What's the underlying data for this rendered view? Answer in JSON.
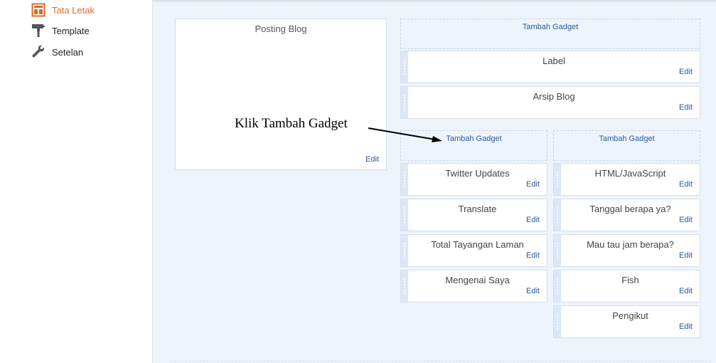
{
  "sidebar": {
    "items": [
      {
        "label": "Tata Letak",
        "icon": "layout-icon",
        "active": true
      },
      {
        "label": "Template",
        "icon": "paint-roller-icon",
        "active": false
      },
      {
        "label": "Setelan",
        "icon": "wrench-icon",
        "active": false
      }
    ]
  },
  "colors": {
    "active_nav": "#dd6a2a",
    "link": "#2a5a9a",
    "canvas": "#eef4fc"
  },
  "main_panel": {
    "title": "Posting Blog",
    "edit_label": "Edit"
  },
  "add_gadget_label": "Tambah Gadget",
  "annotation": "Klik Tambah Gadget",
  "right_top": {
    "gadgets": [
      {
        "title": "Label",
        "edit": "Edit"
      },
      {
        "title": "Arsip Blog",
        "edit": "Edit"
      }
    ]
  },
  "col_left": {
    "gadgets": [
      {
        "title": "Twitter Updates",
        "edit": "Edit"
      },
      {
        "title": "Translate",
        "edit": "Edit"
      },
      {
        "title": "Total Tayangan Laman",
        "edit": "Edit"
      },
      {
        "title": "Mengenai Saya",
        "edit": "Edit"
      }
    ]
  },
  "col_right": {
    "gadgets": [
      {
        "title": "HTML/JavaScript",
        "edit": "Edit"
      },
      {
        "title": "Tanggal berapa ya?",
        "edit": "Edit"
      },
      {
        "title": "Mau tau jam berapa?",
        "edit": "Edit"
      },
      {
        "title": "Fish",
        "edit": "Edit"
      },
      {
        "title": "Pengikut",
        "edit": "Edit"
      }
    ]
  }
}
